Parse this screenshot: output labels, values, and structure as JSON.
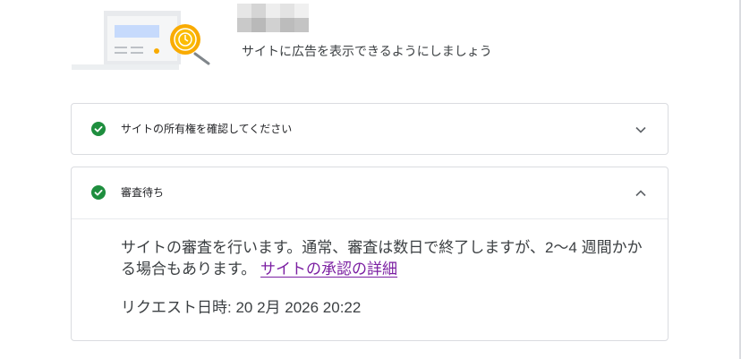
{
  "header": {
    "icon": "site-review-illustration",
    "description": "サイトに広告を表示できるようにしましょう"
  },
  "cards": [
    {
      "title": "サイトの所有権を確認してください",
      "status_icon": "check-circle-icon",
      "toggle_icon": "chevron-down-icon",
      "expanded": false
    },
    {
      "title": "審査待ち",
      "status_icon": "check-circle-icon",
      "toggle_icon": "chevron-up-icon",
      "expanded": true,
      "body": {
        "description": "サイトの審査を行います。通常、審査は数日で終了しますが、2〜4 週間かかる場合もあります。",
        "link_label": "サイトの承認の詳細",
        "request_label": "リクエスト日時: 20 2月 2026 20:22"
      }
    }
  ],
  "colors": {
    "success": "#1e8e3e",
    "link": "#7b1fa2",
    "border": "#dadce0",
    "clock": "#f9ab00"
  }
}
